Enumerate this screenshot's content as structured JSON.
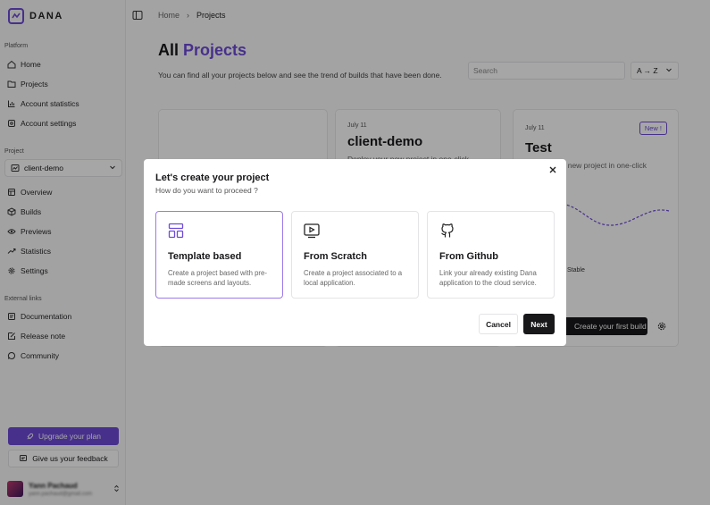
{
  "app": {
    "name": "DANA",
    "accent": "#6d4bd8"
  },
  "sidebar": {
    "platform_label": "Platform",
    "platform_items": [
      {
        "label": "Home",
        "icon": "home-icon"
      },
      {
        "label": "Projects",
        "icon": "folder-icon"
      },
      {
        "label": "Account statistics",
        "icon": "chart-icon"
      },
      {
        "label": "Account settings",
        "icon": "settings-icon"
      }
    ],
    "project_label": "Project",
    "project_select": "client-demo",
    "project_items": [
      {
        "label": "Overview",
        "icon": "grid-icon"
      },
      {
        "label": "Builds",
        "icon": "box-icon"
      },
      {
        "label": "Previews",
        "icon": "eye-icon"
      },
      {
        "label": "Statistics",
        "icon": "trend-icon"
      },
      {
        "label": "Settings",
        "icon": "gear-icon"
      }
    ],
    "external_label": "External links",
    "external_items": [
      {
        "label": "Documentation",
        "icon": "book-icon"
      },
      {
        "label": "Release note",
        "icon": "note-icon"
      },
      {
        "label": "Community",
        "icon": "chat-icon"
      }
    ],
    "upgrade_label": "Upgrade your plan",
    "feedback_label": "Give us your feedback",
    "user": {
      "name": "Yann Pachaud",
      "email": "yann.pachaud@gmail.com"
    }
  },
  "breadcrumb": {
    "home": "Home",
    "separator": "›",
    "current": "Projects"
  },
  "main": {
    "title_prefix": "All",
    "title_accent": "Projects",
    "subtitle": "You can find all your projects below and see the trend of builds that have been done.",
    "search_placeholder": "Search",
    "sort_label": "A → Z"
  },
  "cards": [
    {
      "date": "July 11",
      "title": "client-demo",
      "desc": "Deploy your new project in one-click"
    },
    {
      "date": "July 11",
      "title": "Test",
      "desc": "Deploy your new project in one-click",
      "badge": "New !",
      "status": "Stable",
      "build_label": "Create your first build"
    }
  ],
  "modal": {
    "title": "Let's create your project",
    "subtitle": "How do you want to proceed ?",
    "options": [
      {
        "title": "Template based",
        "desc": "Create a project based with pre-made screens and layouts.",
        "icon": "layout-icon"
      },
      {
        "title": "From Scratch",
        "desc": "Create a project associated to a local application.",
        "icon": "play-screen-icon"
      },
      {
        "title": "From Github",
        "desc": "Link your already existing Dana application to the cloud service.",
        "icon": "github-icon"
      }
    ],
    "cancel_label": "Cancel",
    "next_label": "Next"
  }
}
